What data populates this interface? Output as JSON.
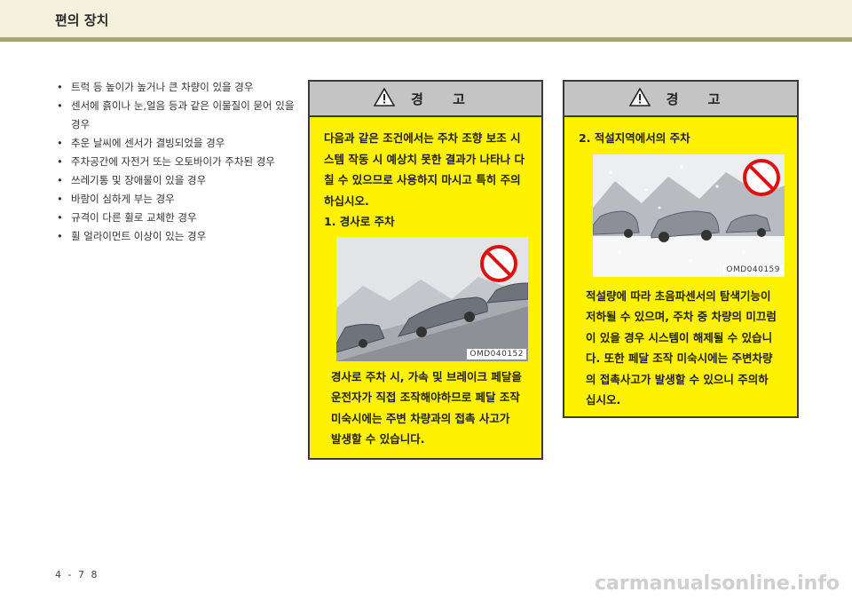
{
  "header": {
    "title": "편의 장치"
  },
  "bullets": [
    "트럭 등 높이가 높거나 큰 차량이 있을 경우",
    "센서에 흙이나 눈,얼음 등과 같은 이물질이 묻어 있을 경우",
    "추운 날씨에 센서가 결빙되었을 경우",
    "주차공간에 자전거 또는 오토바이가 주차된 경우",
    "쓰레기통 및 장애물이 있을 경우",
    "바람이 심하게 부는 경우",
    "규격이 다른 휠로 교체한 경우",
    "휠 얼라이먼트 이상이 있는 경우"
  ],
  "warning_left": {
    "title": "경  고",
    "intro": "다음과 같은 조건에서는 주차 조향 보조 시스템 작동 시 예상치 못한 결과가 나타나 다칠 수 있으므로 사용하지 마시고 특히 주의하십시오.",
    "step": "1.  경사로 주차",
    "image_code": "OMD040152",
    "caption": "경사로 주차 시, 가속 및 브레이크 페달을 운전자가 직접 조작해야하므로 페달 조작 미숙시에는 주변 차량과의 접촉 사고가 발생할 수 있습니다."
  },
  "warning_right": {
    "title": "경  고",
    "step": "2.  적설지역에서의 주차",
    "image_code": "OMD040159",
    "caption": "적설량에 따라 초음파센서의 탐색기능이 저하될 수 있으며, 주차 중 차량의 미끄럼이 있을 경우 시스템이 해제될 수 있습니다. 또한 페달 조작 미숙시에는 주변차량의 접촉사고가 발생할 수 있으니 주의하십시오."
  },
  "icons": {
    "warning": "warning-triangle-icon",
    "prohibited": "no-entry-icon"
  },
  "colors": {
    "warning_bg": "#fff200",
    "header_bar": "#c4c4c4",
    "rule": "#a8a478"
  },
  "page_number": "4 - 7 8",
  "watermark": "carmanualsonline.info"
}
